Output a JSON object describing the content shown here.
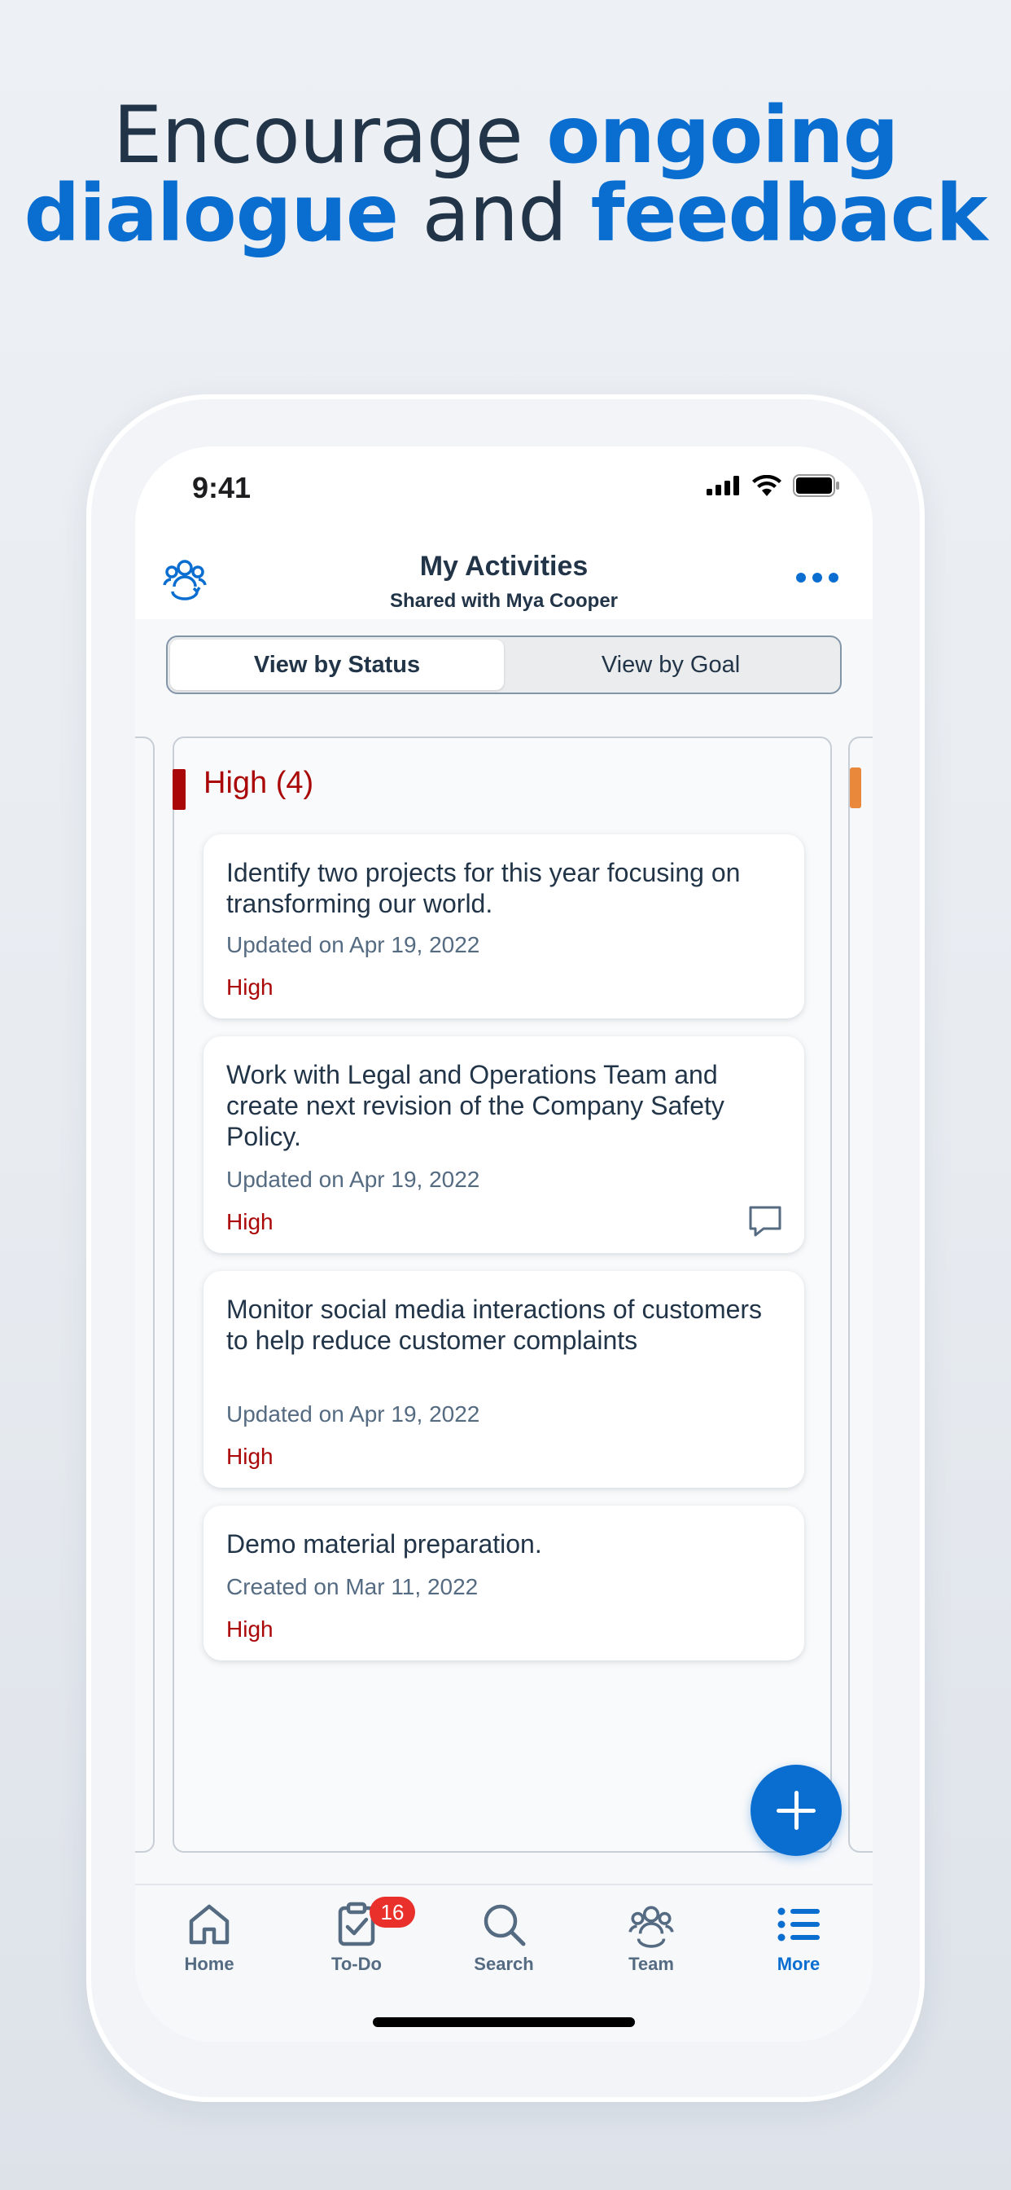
{
  "headline": {
    "line1_plain": "Encourage ",
    "line1_highlight": "ongoing",
    "line2_highlight1": "dialogue",
    "line2_plain": " and ",
    "line2_highlight2": "feedback"
  },
  "status_bar": {
    "time": "9:41"
  },
  "nav": {
    "title": "My Activities",
    "subtitle": "Shared with Mya Cooper",
    "left_icon": "team-icon",
    "right_icon": "more-icon"
  },
  "segmented": {
    "options": [
      "View by Status",
      "View by Goal"
    ],
    "selected": "View by Status"
  },
  "column": {
    "header": "High (4)",
    "accent_color": "#aa0808"
  },
  "cards": [
    {
      "title": "Identify two projects for this year focusing on transforming our world.",
      "date": "Updated on Apr 19, 2022",
      "status": "High",
      "has_comment": false
    },
    {
      "title": "Work with Legal and Operations Team and create next revision of the Company Safety Policy.",
      "date": "Updated on Apr 19, 2022",
      "status": "High",
      "has_comment": true
    },
    {
      "title": "Monitor social media interactions of customers to help reduce customer complaints",
      "date": "Updated on Apr 19, 2022",
      "status": "High",
      "has_comment": false
    },
    {
      "title": "Demo material preparation.",
      "date": "Created on Mar 11, 2022",
      "status": "High",
      "has_comment": false
    }
  ],
  "tabbar": {
    "items": [
      {
        "label": "Home",
        "icon": "home-icon"
      },
      {
        "label": "To-Do",
        "icon": "todo-icon",
        "badge": "16"
      },
      {
        "label": "Search",
        "icon": "search-icon"
      },
      {
        "label": "Team",
        "icon": "team-icon"
      },
      {
        "label": "More",
        "icon": "list-icon"
      }
    ],
    "active": "More"
  },
  "colors": {
    "accent": "#0a6ed1",
    "high": "#aa0808",
    "text": "#223548",
    "badge": "#e9302b"
  }
}
